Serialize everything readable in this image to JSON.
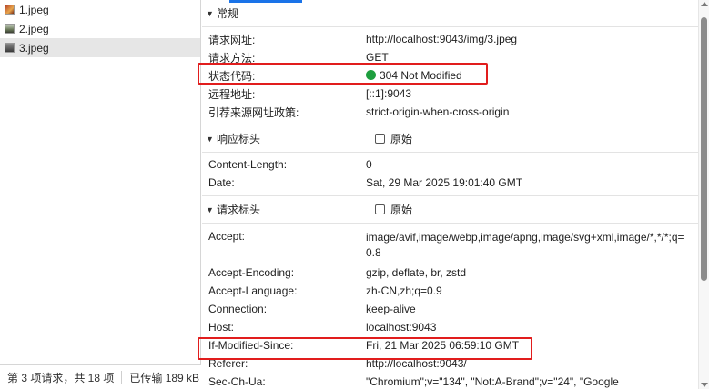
{
  "files": [
    {
      "name": "1.jpeg"
    },
    {
      "name": "2.jpeg"
    },
    {
      "name": "3.jpeg"
    }
  ],
  "status_bar": {
    "requests": "第 3 项请求，共 18 项",
    "transferred": "已传输 189 kB"
  },
  "general": {
    "title": "常规",
    "rows": [
      {
        "key": "请求网址:",
        "value": "http://localhost:9043/img/3.jpeg"
      },
      {
        "key": "请求方法:",
        "value": "GET"
      },
      {
        "key": "状态代码:",
        "value": "304 Not Modified"
      },
      {
        "key": "远程地址:",
        "value": "[::1]:9043"
      },
      {
        "key": "引荐来源网址政策:",
        "value": "strict-origin-when-cross-origin"
      }
    ]
  },
  "response_headers": {
    "title": "响应标头",
    "raw_label": "原始",
    "rows": [
      {
        "key": "Content-Length:",
        "value": "0"
      },
      {
        "key": "Date:",
        "value": "Sat, 29 Mar 2025 19:01:40 GMT"
      }
    ]
  },
  "request_headers": {
    "title": "请求标头",
    "raw_label": "原始",
    "rows": [
      {
        "key": "Accept:",
        "value": "image/avif,image/webp,image/apng,image/svg+xml,image/*,*/*;q=0.8"
      },
      {
        "key": "Accept-Encoding:",
        "value": "gzip, deflate, br, zstd"
      },
      {
        "key": "Accept-Language:",
        "value": "zh-CN,zh;q=0.9"
      },
      {
        "key": "Connection:",
        "value": "keep-alive"
      },
      {
        "key": "Host:",
        "value": "localhost:9043"
      },
      {
        "key": "If-Modified-Since:",
        "value": "Fri, 21 Mar 2025 06:59:10 GMT"
      },
      {
        "key": "Referer:",
        "value": "http://localhost:9043/"
      },
      {
        "key": "Sec-Ch-Ua:",
        "value": "\"Chromium\";v=\"134\", \"Not:A-Brand\";v=\"24\", \"Google"
      }
    ]
  },
  "colors": {
    "status_ok": "#1e9e3e",
    "highlight": "#e11d1d",
    "tab_accent": "#1a73e8"
  }
}
